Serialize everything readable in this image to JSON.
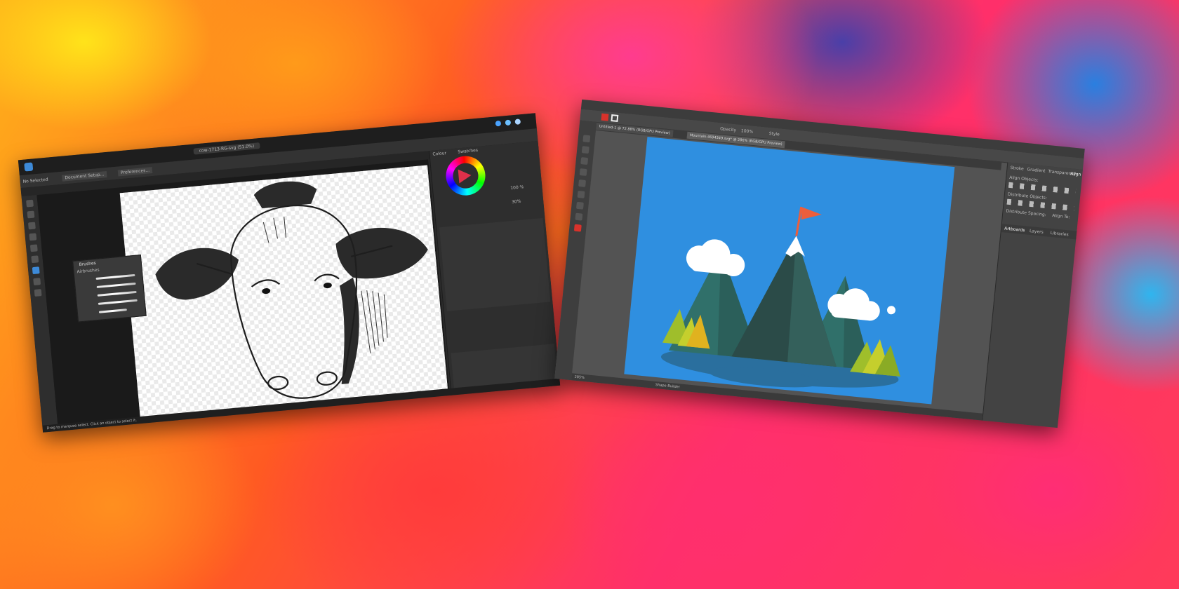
{
  "affinity": {
    "document_title": "cow-1713-RG-svg (51.0%)",
    "no_selection": "No Selected",
    "buttons": [
      "Document Setup...",
      "Preferences..."
    ],
    "status_hint": "Drag to marquee select. Click an object to select it.",
    "brushes_panel": {
      "title": "Brushes",
      "category": "Airbrushes"
    },
    "right_panel_tabs": [
      "Colour",
      "Swatches"
    ],
    "brush_sizes": [
      "30%",
      "100 %"
    ]
  },
  "illustrator": {
    "tabs": [
      {
        "label": "Untitled-1 @ 72.88% (RGB/GPU Preview)"
      },
      {
        "label": "Mountain-4694349.svg* @ 286% (RGB/GPU Preview)"
      }
    ],
    "opacity_label": "Opacity",
    "opacity_value": "100%",
    "style_label": "Style",
    "zoom": "285%",
    "status_tool": "Shape Builder",
    "panel_tabs": [
      "Stroke",
      "Gradient",
      "Transparency"
    ],
    "align_title": "Align",
    "align_objects": "Align Objects:",
    "distribute_objects": "Distribute Objects:",
    "distribute_spacing": "Distribute Spacing:",
    "align_to": "Align To:",
    "layer_tabs": [
      "Artboards",
      "Layers",
      "Libraries"
    ]
  },
  "colors": {
    "affinity_chrome": "#2b2b2b",
    "illustrator_chrome": "#535353",
    "artboard_blue": "#2f8fe0",
    "flag_orange": "#ec5e3c",
    "mountain_dark": "#2b4b48",
    "mountain_mid": "#30706a",
    "tree_green": "#9fbe2b"
  }
}
